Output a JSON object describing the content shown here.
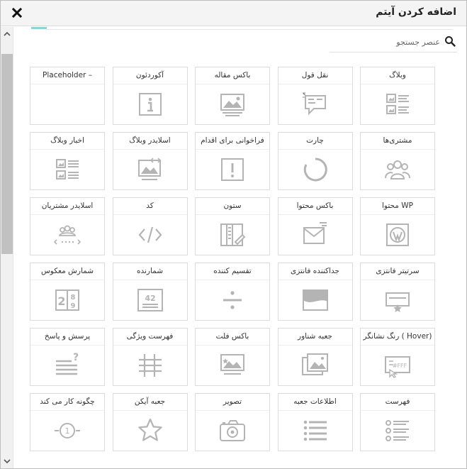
{
  "dialog": {
    "title": "اضافه کردن آیتم",
    "close_icon": "close-icon"
  },
  "search": {
    "placeholder": "عنصر جستجو",
    "value": "",
    "icon": "search-icon"
  },
  "colors": {
    "icon_gray": "#b4b4b4",
    "accent": "#8fd3d6",
    "border": "#dcdcdc"
  },
  "items": [
    {
      "label": "وبلاگ",
      "icon": "blog-icon"
    },
    {
      "label": "نقل قول",
      "icon": "quote-icon"
    },
    {
      "label": "باکس مقاله",
      "icon": "image-box-icon"
    },
    {
      "label": "آکوردئون",
      "icon": "info-icon"
    },
    {
      "label": "Placeholder –",
      "icon": "placeholder-icon"
    },
    {
      "label": "مشتری‌ها",
      "icon": "clients-icon"
    },
    {
      "label": "چارت",
      "icon": "chart-circle-icon"
    },
    {
      "label": "فراخوانی برای اقدام",
      "icon": "call-to-action-icon"
    },
    {
      "label": "اسلایدر وبلاگ",
      "icon": "blog-slider-icon"
    },
    {
      "label": "اخبار وبلاگ",
      "icon": "blog-news-icon"
    },
    {
      "label": "محتوا WP",
      "icon": "wordpress-icon"
    },
    {
      "label": "باکس محتوا",
      "icon": "envelope-icon"
    },
    {
      "label": "ستون",
      "icon": "column-icon"
    },
    {
      "label": "کد",
      "icon": "code-icon"
    },
    {
      "label": "اسلایدر مشتریان",
      "icon": "clients-slider-icon"
    },
    {
      "label": "سرتیتر فانتزی",
      "icon": "fancy-heading-icon"
    },
    {
      "label": "جداکننده فانتزی",
      "icon": "fancy-divider-icon"
    },
    {
      "label": "تقسیم کننده",
      "icon": "divider-icon"
    },
    {
      "label": "شمارنده",
      "icon": "counter-icon"
    },
    {
      "label": "شمارش معکوس",
      "icon": "countdown-icon"
    },
    {
      "label": "رنگ نشانگر ( Hover)",
      "icon": "hover-color-icon"
    },
    {
      "label": "جعبه شناور",
      "icon": "hover-box-icon"
    },
    {
      "label": "باکس فلت",
      "icon": "flat-box-icon"
    },
    {
      "label": "فهرست ویژگی",
      "icon": "feature-list-icon"
    },
    {
      "label": "پرسش و پاسخ",
      "icon": "faq-icon"
    },
    {
      "label": "فهرست",
      "icon": "list-icon"
    },
    {
      "label": "اطلاعات جعبه",
      "icon": "info-box-icon"
    },
    {
      "label": "تصویر",
      "icon": "camera-icon"
    },
    {
      "label": "جعبه آیکن",
      "icon": "star-icon"
    },
    {
      "label": "چگونه کار می کند",
      "icon": "how-it-works-icon"
    }
  ]
}
